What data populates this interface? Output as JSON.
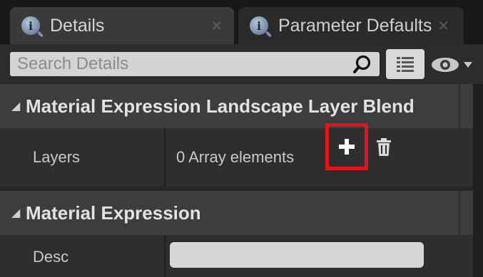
{
  "tabs": [
    {
      "label": "Details",
      "icon": "details-info-icon",
      "active": true
    },
    {
      "label": "Parameter Defaults",
      "icon": "details-info-icon",
      "active": false
    }
  ],
  "search": {
    "placeholder": "Search Details",
    "value": ""
  },
  "toolbar": {
    "view_options_icon": "grid-list-icon",
    "visibility_icon": "eye-icon"
  },
  "categories": [
    {
      "label": "Material Expression Landscape Layer Blend",
      "rows": [
        {
          "label": "Layers",
          "value": "0 Array elements",
          "add_icon": "plus-icon",
          "clear_icon": "trash-icon"
        }
      ]
    },
    {
      "label": "Material Expression",
      "rows": [
        {
          "label": "Desc",
          "value": ""
        }
      ]
    }
  ],
  "colors": {
    "highlight": "#e0161d",
    "background": "#262626",
    "category": "#3d3d3d"
  }
}
